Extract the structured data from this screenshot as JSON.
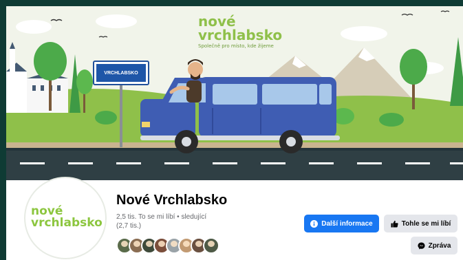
{
  "cover": {
    "brand_line1": "nové",
    "brand_line2": "vrchlabsko",
    "tagline": "Společně pro místo, kde žijeme",
    "road_sign_text": "VRCHLABSKO"
  },
  "profile": {
    "logo_line1": "nové",
    "logo_line2": "vrchlabsko"
  },
  "page": {
    "name": "Nové Vrchlabsko",
    "stats_line1": "2,5 tis. To se mi líbí • sledující",
    "stats_line2": "(2,7 tis.)"
  },
  "buttons": {
    "info_label": "Další informace",
    "like_label": "Tohle se mi líbí",
    "message_label": "Zpráva"
  },
  "avatars": [
    "avatar-1",
    "avatar-2",
    "avatar-3",
    "avatar-4",
    "avatar-5",
    "avatar-6",
    "avatar-7",
    "avatar-8"
  ],
  "colors": {
    "brand_green": "#8cc63f",
    "primary_blue": "#1877f2",
    "button_gray": "#e4e6eb",
    "frame_bg": "#0f3b34"
  }
}
